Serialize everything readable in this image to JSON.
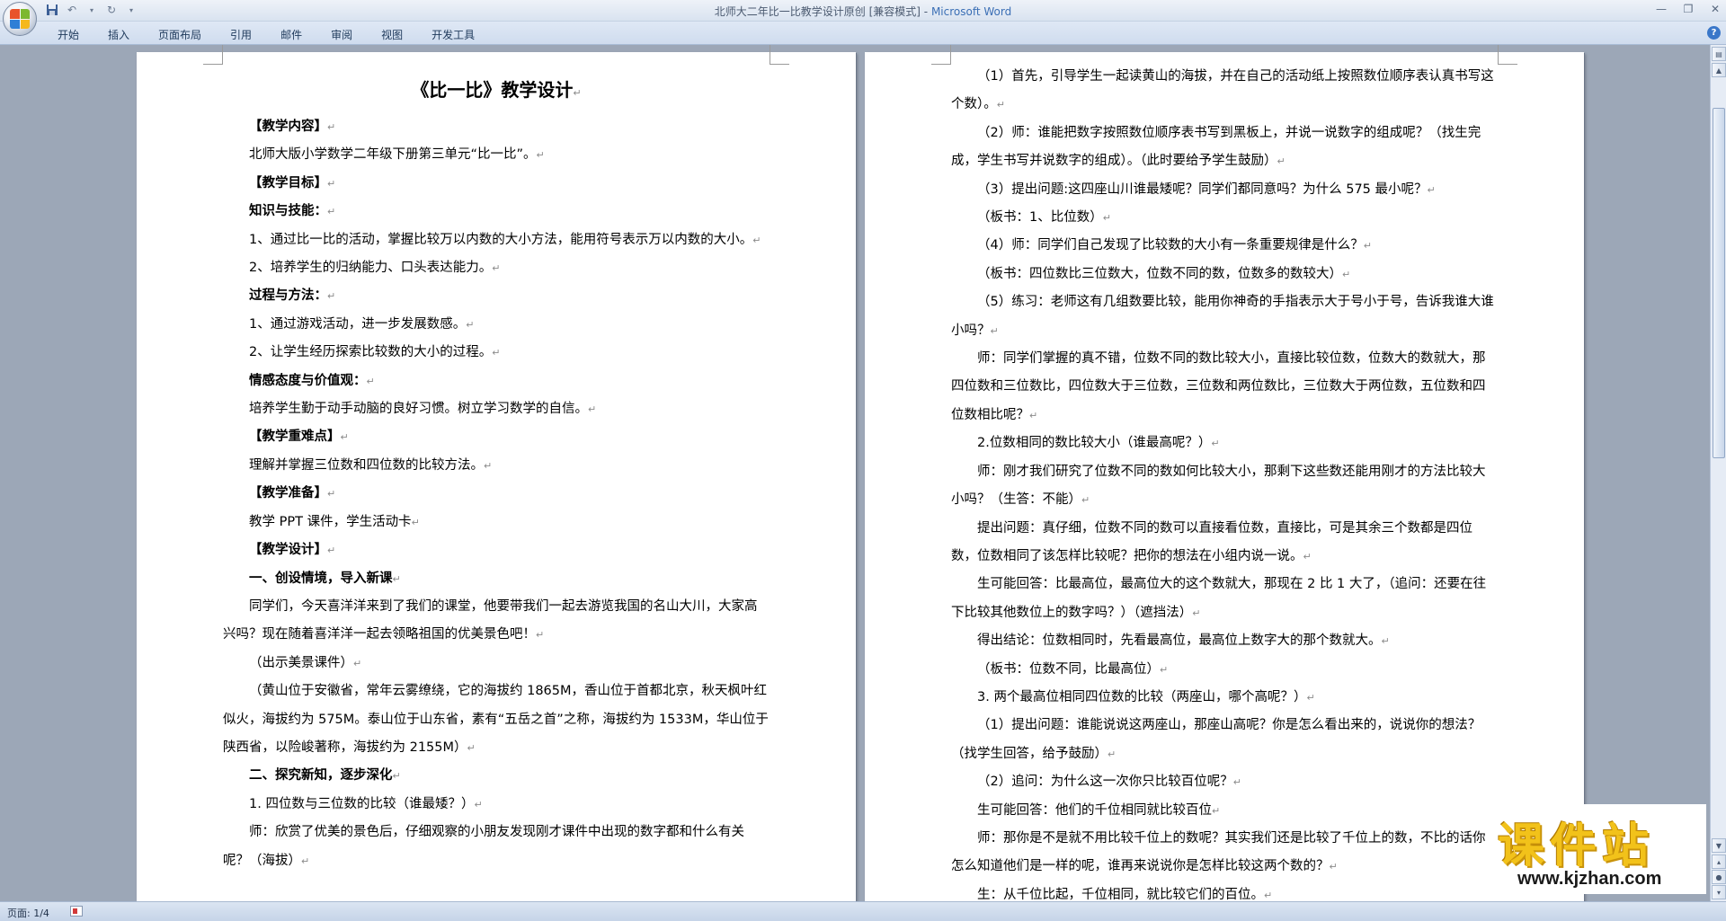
{
  "titlebar": {
    "doc_name": "北师大二年比一比教学设计原创 [兼容模式]",
    "separator": " - ",
    "app_name": "Microsoft Word"
  },
  "ribbon": {
    "tabs": [
      "开始",
      "插入",
      "页面布局",
      "引用",
      "邮件",
      "审阅",
      "视图",
      "开发工具"
    ]
  },
  "page1": {
    "title": "《比一比》教学设计",
    "paragraphs": [
      {
        "text": "【教学内容】",
        "style": "bold"
      },
      {
        "text": "北师大版小学数学二年级下册第三单元“比一比”。"
      },
      {
        "text": "【教学目标】",
        "style": "bold"
      },
      {
        "text": "知识与技能：",
        "style": "bold"
      },
      {
        "text": "1、通过比一比的活动，掌握比较万以内数的大小方法，能用符号表示万以内数的大小。"
      },
      {
        "text": "2、培养学生的归纳能力、口头表达能力。"
      },
      {
        "text": "过程与方法：",
        "style": "bold"
      },
      {
        "text": "1、通过游戏活动，进一步发展数感。"
      },
      {
        "text": "2、让学生经历探索比较数的大小的过程。"
      },
      {
        "text": "情感态度与价值观：",
        "style": "bold"
      },
      {
        "text": "培养学生勤于动手动脑的良好习惯。树立学习数学的自信。"
      },
      {
        "text": "【教学重难点】",
        "style": "bold"
      },
      {
        "text": "理解并掌握三位数和四位数的比较方法。"
      },
      {
        "text": "【教学准备】",
        "style": "bold"
      },
      {
        "text": "教学 PPT 课件，学生活动卡"
      },
      {
        "text": "【教学设计】",
        "style": "bold"
      },
      {
        "text": "一、创设情境，导入新课",
        "style": "bold"
      },
      {
        "text": "同学们，今天喜洋洋来到了我们的课堂，他要带我们一起去游览我国的名山大川，大家高兴吗？现在随着喜洋洋一起去领略祖国的优美景色吧！"
      },
      {
        "text": "（出示美景课件）"
      },
      {
        "text": "（黄山位于安徽省，常年云雾缭绕，它的海拔约 1865M，香山位于首都北京，秋天枫叶红似火，海拔约为 575M。泰山位于山东省，素有“五岳之首”之称，海拔约为 1533M，华山位于陕西省，以险峻著称，海拔约为 2155M）"
      },
      {
        "text": "二、探究新知，逐步深化",
        "style": "bold"
      },
      {
        "text": "1. 四位数与三位数的比较（谁最矮？）"
      },
      {
        "text": "师：欣赏了优美的景色后，仔细观察的小朋友发现刚才课件中出现的数字都和什么有关呢？（海拔）"
      }
    ]
  },
  "page2": {
    "paragraphs": [
      {
        "text": "（1）首先，引导学生一起读黄山的海拔，并在自己的活动纸上按照数位顺序表认真书写这个数）。"
      },
      {
        "text": "（2）师：谁能把数字按照数位顺序表书写到黑板上，并说一说数字的组成呢？（找生完成，学生书写并说数字的组成）。（此时要给予学生鼓励）"
      },
      {
        "text": "（3）提出问题:这四座山川谁最矮呢？同学们都同意吗？为什么 575 最小呢？"
      },
      {
        "text": "（板书：1、比位数）"
      },
      {
        "text": "（4）师：同学们自己发现了比较数的大小有一条重要规律是什么？"
      },
      {
        "text": "（板书：四位数比三位数大，位数不同的数，位数多的数较大）"
      },
      {
        "text": "（5）练习：老师这有几组数要比较，能用你神奇的手指表示大于号小于号，告诉我谁大谁小吗？"
      },
      {
        "text": "师：同学们掌握的真不错，位数不同的数比较大小，直接比较位数，位数大的数就大，那四位数和三位数比，四位数大于三位数，三位数和两位数比，三位数大于两位数，五位数和四位数相比呢？"
      },
      {
        "text": "2.位数相同的数比较大小（谁最高呢？）"
      },
      {
        "text": "师：刚才我们研究了位数不同的数如何比较大小，那剩下这些数还能用刚才的方法比较大小吗？（生答：不能）"
      },
      {
        "text": "提出问题：真仔细，位数不同的数可以直接看位数，直接比，可是其余三个数都是四位数，位数相同了该怎样比较呢？把你的想法在小组内说一说。"
      },
      {
        "text": "生可能回答：比最高位，最高位大的这个数就大，那现在 2 比 1 大了，（追问：还要在往下比较其他数位上的数字吗？）（遮挡法）"
      },
      {
        "text": "得出结论：位数相同时，先看最高位，最高位上数字大的那个数就大。"
      },
      {
        "text": "（板书：位数不同，比最高位）"
      },
      {
        "text": "3. 两个最高位相同四位数的比较（两座山，哪个高呢？）"
      },
      {
        "text": "（1）提出问题：谁能说说这两座山，那座山高呢？你是怎么看出来的，说说你的想法？（找学生回答，给予鼓励）"
      },
      {
        "text": "（2）追问：为什么这一次你只比较百位呢？"
      },
      {
        "text": "生可能回答：他们的千位相同就比较百位"
      },
      {
        "text": "师：那你是不是就不用比较千位上的数呢？其实我们还是比较了千位上的数，不比的话你怎么知道他们是一样的呢，谁再来说说你是怎样比较这两个数的？"
      },
      {
        "text": "生：从千位比起，千位相同，就比较它们的百位。"
      }
    ]
  },
  "paragraph_mark": "↵",
  "statusbar": {
    "page_info": "页面: 1/4"
  },
  "watermark": {
    "brand": "课件站",
    "url": "www.kjzhan.com"
  },
  "colors": {
    "app_name": "#3b6fb5",
    "workspace": "#9ca7b7",
    "watermark_text": "#f2c21a"
  }
}
